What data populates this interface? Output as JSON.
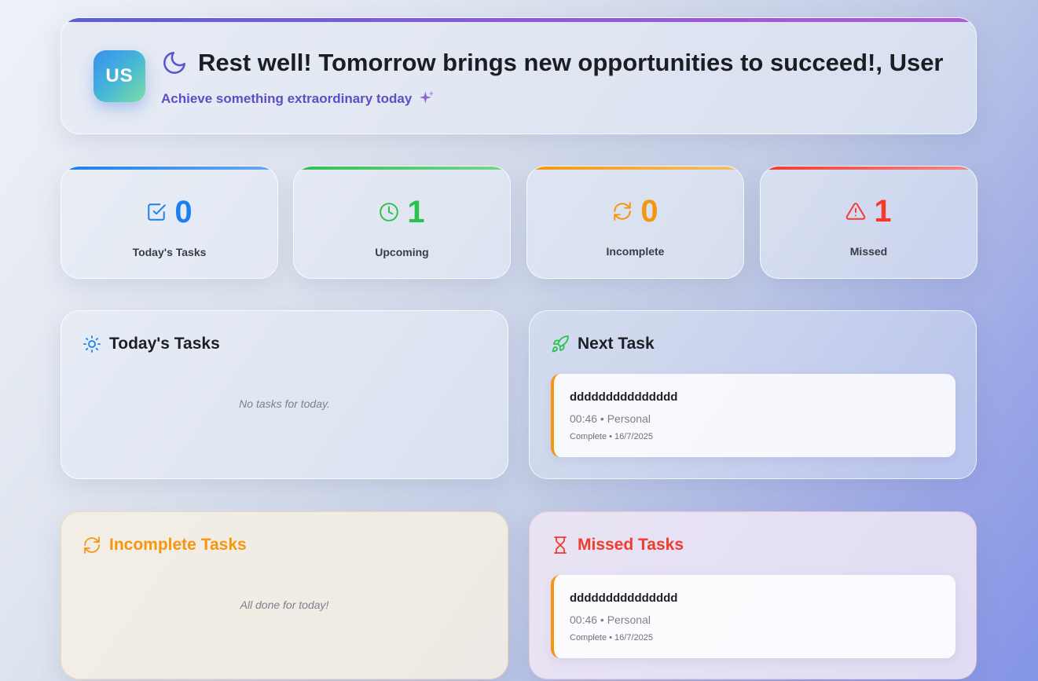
{
  "header": {
    "avatar_initials": "US",
    "greeting": "Rest well! Tomorrow brings new opportunities to succeed!, User",
    "subtitle": "Achieve something extraordinary today",
    "greeting_icon": "moon-icon",
    "subtitle_icon": "sparkle-icon",
    "accent_gradient": [
      "#5a5fd6",
      "#b05ad8"
    ]
  },
  "stats": [
    {
      "label": "Today's Tasks",
      "value": "0",
      "icon": "check-square-icon",
      "color": "#1a7ff0"
    },
    {
      "label": "Upcoming",
      "value": "1",
      "icon": "clock-icon",
      "color": "#2cc04f"
    },
    {
      "label": "Incomplete",
      "value": "0",
      "icon": "refresh-icon",
      "color": "#f5960e"
    },
    {
      "label": "Missed",
      "value": "1",
      "icon": "alert-triangle-icon",
      "color": "#f23a2f"
    }
  ],
  "panels": {
    "today": {
      "title": "Today's Tasks",
      "icon": "sun-icon",
      "empty_text": "No tasks for today."
    },
    "next": {
      "title": "Next Task",
      "icon": "rocket-icon",
      "task": {
        "name": "ddddddddddddddd",
        "meta": "00:46 • Personal",
        "status": "Complete • 16/7/2025"
      }
    },
    "incomplete": {
      "title": "Incomplete Tasks",
      "icon": "refresh-icon",
      "empty_text": "All done for today!",
      "color": "#f5960e"
    },
    "missed": {
      "title": "Missed Tasks",
      "icon": "hourglass-icon",
      "color": "#f23a2f",
      "task": {
        "name": "ddddddddddddddd",
        "meta": "00:46 • Personal",
        "status": "Complete • 16/7/2025"
      }
    }
  }
}
